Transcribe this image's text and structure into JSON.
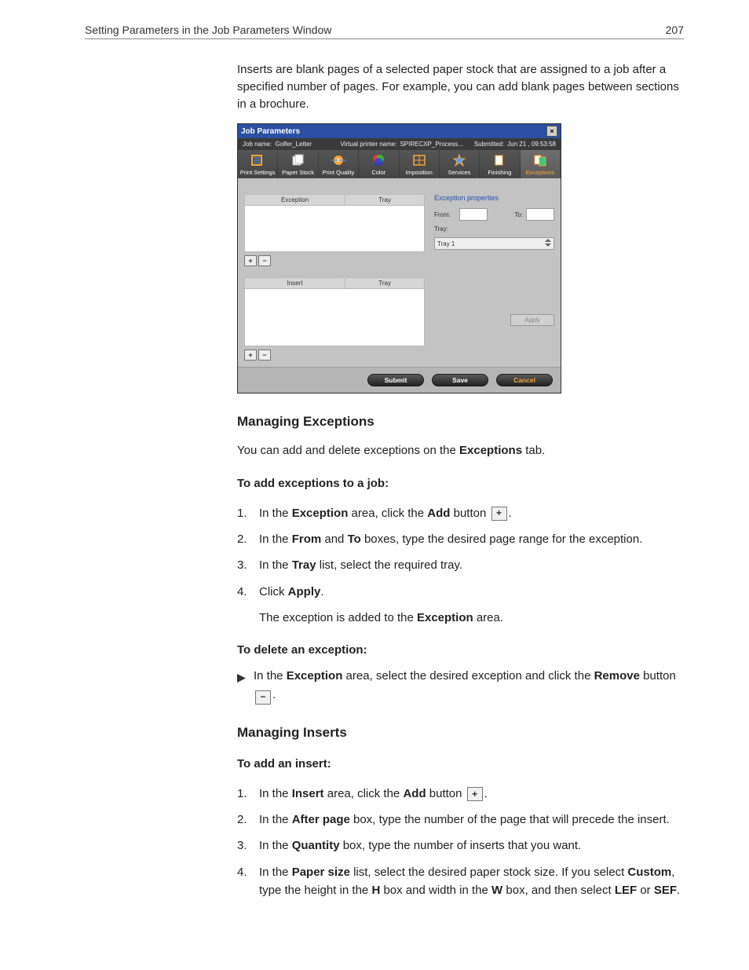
{
  "header": {
    "title": "Setting Parameters in the Job Parameters Window",
    "page": "207"
  },
  "intro": "Inserts are blank pages of a selected paper stock that are assigned to a job after a specified number of pages. For example, you can add blank pages between sections in a brochure.",
  "dialog": {
    "title": "Job Parameters",
    "job_name_label": "Job name:",
    "job_name": "Golfer_Letter",
    "vp_label": "Virtual printer name:",
    "vp_value": "SPIRECXP_Process...",
    "submitted_label": "Submitted:",
    "submitted_value": "Jun 21 , 09:53:58",
    "tabs": [
      "Print Settings",
      "Paper Stock",
      "Print Quality",
      "Color",
      "Imposition",
      "Services",
      "Finishing",
      "Exceptions"
    ],
    "selected_tab": 7,
    "table1": {
      "h1": "Exception",
      "h2": "Tray"
    },
    "table2": {
      "h1": "Insert",
      "h2": "Tray"
    },
    "props_title": "Exception properties",
    "from_label": "From:",
    "to_label": "To:",
    "tray_label": "Tray:",
    "tray_value": "Tray 1",
    "apply": "Apply",
    "submit": "Submit",
    "save": "Save",
    "cancel": "Cancel"
  },
  "sec_exceptions": {
    "heading": "Managing Exceptions",
    "lead_pre": "You can add and delete exceptions on the ",
    "lead_b": "Exceptions",
    "lead_post": " tab.",
    "add_title": "To add exceptions to a job:",
    "s1": {
      "a": "In the ",
      "b": "Exception",
      "c": " area, click the ",
      "d": "Add",
      "e": " button "
    },
    "s2": {
      "a": "In the ",
      "b": "From",
      "c": " and ",
      "d": "To",
      "e": " boxes, type the desired page range for the exception."
    },
    "s3": {
      "a": "In the ",
      "b": "Tray",
      "c": " list, select the required tray."
    },
    "s4": {
      "a": "Click ",
      "b": "Apply",
      "c": "."
    },
    "s4f": {
      "a": "The exception is added to the ",
      "b": "Exception",
      "c": " area."
    },
    "del_title": "To delete an exception:",
    "del": {
      "a": "In the ",
      "b": "Exception",
      "c": " area, select the desired exception and click the ",
      "d": "Remove",
      "e": " button"
    }
  },
  "sec_inserts": {
    "heading": "Managing Inserts",
    "add_title": "To add an insert:",
    "s1": {
      "a": "In the ",
      "b": "Insert",
      "c": " area, click the ",
      "d": "Add",
      "e": " button "
    },
    "s2": {
      "a": "In the ",
      "b": "After page",
      "c": " box, type the number of the page that will precede the insert."
    },
    "s3": {
      "a": "In the ",
      "b": "Quantity",
      "c": " box, type the number of inserts that you want."
    },
    "s4": {
      "a": "In the ",
      "b": "Paper size",
      "c": " list, select the desired paper stock size. If you select ",
      "d": "Custom",
      "e": ", type the height in the ",
      "f": "H",
      "g": " box and width in the ",
      "h": "W",
      "i": " box, and then select ",
      "j": "LEF",
      "k": " or ",
      "l": "SEF",
      "m": "."
    }
  }
}
